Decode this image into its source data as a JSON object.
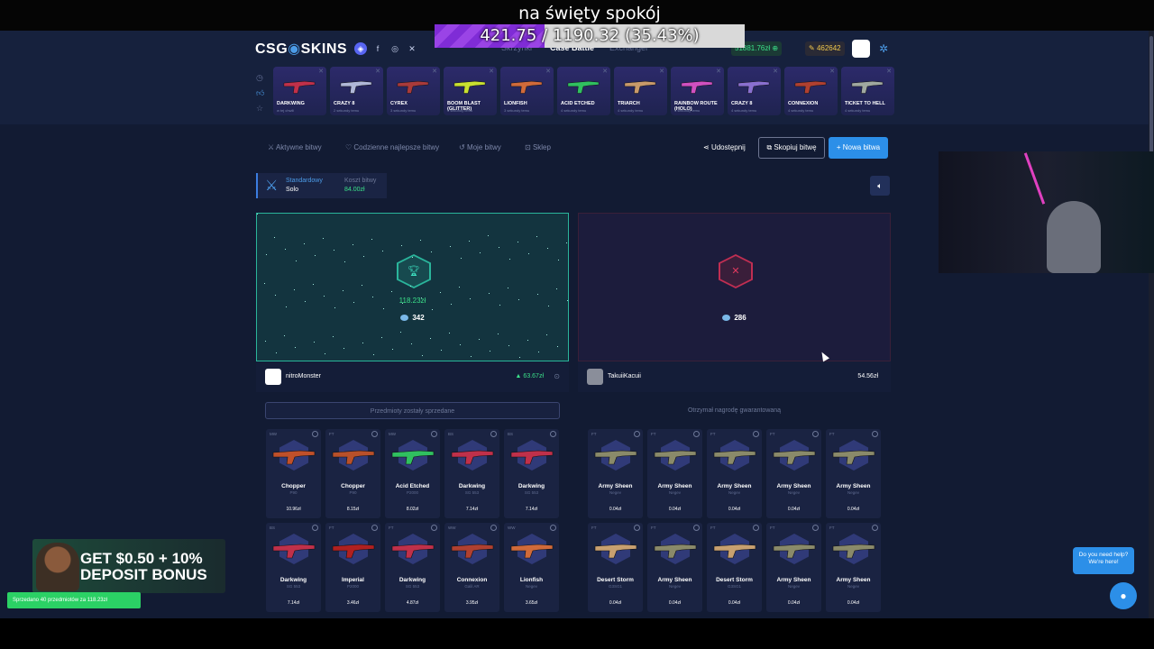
{
  "stream": {
    "title": "na święty spokój",
    "progress_text": "421.75 / 1190.32 (35.43%)",
    "progress_percent": 35.43
  },
  "header": {
    "logo_left": "CSG",
    "logo_right": "SKINS",
    "nav": [
      "Skrzynki",
      "Case Battle",
      "Exchanger"
    ],
    "active_nav": "Case Battle",
    "balance": "51881.76zł",
    "coins": "462642"
  },
  "live_drops": [
    {
      "name": "DARKWING",
      "sub": "w tej chwili",
      "color": "#c0304a"
    },
    {
      "name": "CRAZY 8",
      "sub": "2 sekundy temu",
      "color": "#b0b8d8"
    },
    {
      "name": "CYREX",
      "sub": "3 sekundy temu",
      "color": "#a83a3a"
    },
    {
      "name": "BOOM BLAST (GLITTER)",
      "sub": "3 sekundy temu",
      "color": "#c8e030"
    },
    {
      "name": "LIONFISH",
      "sub": "3 sekundy temu",
      "color": "#d06a3a"
    },
    {
      "name": "ACID ETCHED",
      "sub": "4 sekundy temu",
      "color": "#30c060"
    },
    {
      "name": "TRIARCH",
      "sub": "4 sekundy temu",
      "color": "#c89a6a"
    },
    {
      "name": "RAINBOW ROUTE (HOLO)",
      "sub": "4 sekundy temu",
      "color": "#d050c0"
    },
    {
      "name": "CRAZY 8",
      "sub": "4 sekundy temu",
      "color": "#8a70d0"
    },
    {
      "name": "CONNEXION",
      "sub": "4 sekundy temu",
      "color": "#b04030"
    },
    {
      "name": "TICKET TO HELL",
      "sub": "4 sekundy temu",
      "color": "#a0a8a0"
    }
  ],
  "subnav": [
    "Aktywne bitwy",
    "Codzienne najlepsze bitwy",
    "Moje bitwy",
    "Sklep"
  ],
  "actions": {
    "share": "Udostępnij",
    "copy": "Skopiuj bitwę",
    "new": "Nowa bitwa"
  },
  "mode": {
    "label": "Standardowy",
    "value": "Solo",
    "cost_label": "Koszt bitwy",
    "cost_value": "84.00zł"
  },
  "players": [
    {
      "name": "nitroMonster",
      "prize": "118.23zł",
      "gems": "342",
      "value": "63.67zł",
      "notice": "Przedmioty zostały sprzedane",
      "items": [
        {
          "cond": "MW",
          "name": "Chopper",
          "type": "P90",
          "price": "10.96zł",
          "color": "#c0502a"
        },
        {
          "cond": "FT",
          "name": "Chopper",
          "type": "P90",
          "price": "8.15zł",
          "color": "#b8502a"
        },
        {
          "cond": "MW",
          "name": "Acid Etched",
          "type": "P2000",
          "price": "8.02zł",
          "color": "#30c060"
        },
        {
          "cond": "BS",
          "name": "Darkwing",
          "type": "SG 553",
          "price": "7.14zł",
          "color": "#c0304a"
        },
        {
          "cond": "BS",
          "name": "Darkwing",
          "type": "SG 553",
          "price": "7.14zł",
          "color": "#c0304a"
        },
        {
          "cond": "BS",
          "name": "Darkwing",
          "type": "SG 553",
          "price": "7.14zł",
          "color": "#c0304a"
        },
        {
          "cond": "FT",
          "name": "Imperial",
          "type": "P2000",
          "price": "3.46zł",
          "color": "#b02020"
        },
        {
          "cond": "FT",
          "name": "Darkwing",
          "type": "SG 553",
          "price": "4.87zł",
          "color": "#c0304a"
        },
        {
          "cond": "WW",
          "name": "Connexion",
          "type": "Galil AR",
          "price": "3.95zł",
          "color": "#b04030"
        },
        {
          "cond": "WW",
          "name": "Lionfish",
          "type": "Negev",
          "price": "3.65zł",
          "color": "#d06a3a"
        }
      ]
    },
    {
      "name": "TakuiiKacuii",
      "gems": "286",
      "value": "54.56zł",
      "notice": "Otrzymał nagrodę gwarantowaną",
      "items": [
        {
          "cond": "FT",
          "name": "Army Sheen",
          "type": "Negev",
          "price": "0.04zł",
          "color": "#8a8a6a"
        },
        {
          "cond": "FT",
          "name": "Army Sheen",
          "type": "Negev",
          "price": "0.04zł",
          "color": "#8a8a6a"
        },
        {
          "cond": "FT",
          "name": "Army Sheen",
          "type": "Negev",
          "price": "0.04zł",
          "color": "#8a8a6a"
        },
        {
          "cond": "FT",
          "name": "Army Sheen",
          "type": "Negev",
          "price": "0.04zł",
          "color": "#8a8a6a"
        },
        {
          "cond": "FT",
          "name": "Army Sheen",
          "type": "Negev",
          "price": "0.04zł",
          "color": "#8a8a6a"
        },
        {
          "cond": "FT",
          "name": "Desert Storm",
          "type": "G3SG1",
          "price": "0.04zł",
          "color": "#c8a070"
        },
        {
          "cond": "FT",
          "name": "Army Sheen",
          "type": "Negev",
          "price": "0.04zł",
          "color": "#8a8a6a"
        },
        {
          "cond": "FT",
          "name": "Desert Storm",
          "type": "G3SG1",
          "price": "0.04zł",
          "color": "#c8a070"
        },
        {
          "cond": "FT",
          "name": "Army Sheen",
          "type": "Negev",
          "price": "0.04zł",
          "color": "#8a8a6a"
        },
        {
          "cond": "FT",
          "name": "Army Sheen",
          "type": "Negev",
          "price": "0.04zł",
          "color": "#8a8a6a"
        }
      ]
    }
  ],
  "promo": {
    "line1": "GET $0.50 + 10%",
    "line2": "DEPOSIT BONUS"
  },
  "toast": "Sprzedano 40 przedmiotów za 118.23zł",
  "help": {
    "line1": "Do you need help?",
    "line2": "We're here!"
  }
}
